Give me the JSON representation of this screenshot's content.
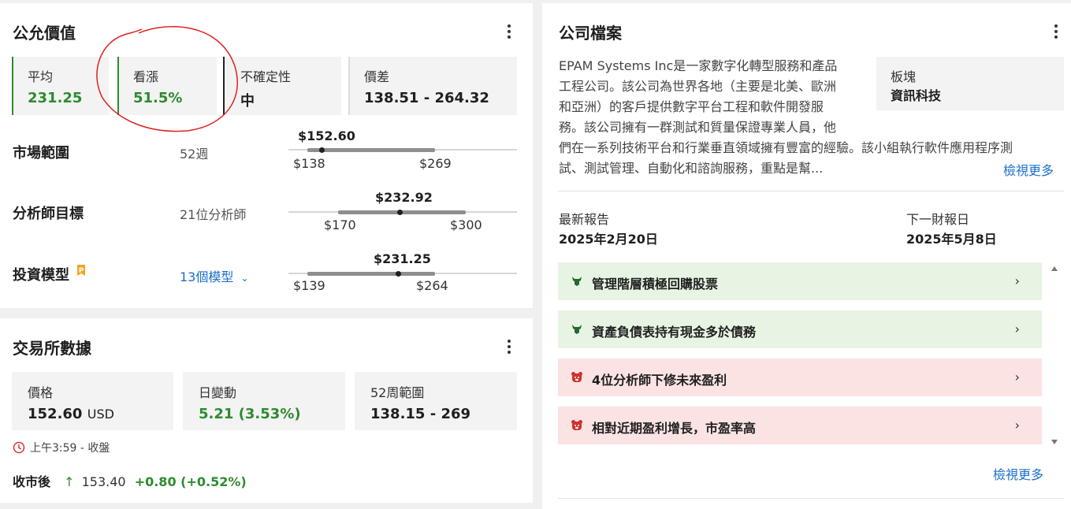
{
  "fair_value": {
    "title": "公允價值",
    "stats": [
      {
        "label": "平均",
        "value": "231.25"
      },
      {
        "label": "看漲",
        "value": "51.5%"
      },
      {
        "label": "不確定性",
        "value": "中"
      },
      {
        "label": "價差",
        "value": "138.51 - 264.32"
      }
    ],
    "rows": [
      {
        "label": "市場範圍",
        "sub": "52週",
        "current": "$152.60",
        "low": "$138",
        "high": "$269"
      },
      {
        "label": "分析師目標",
        "sub": "21位分析師",
        "current": "$232.92",
        "low": "$170",
        "high": "$300"
      },
      {
        "label": "投資模型",
        "sub": "13個模型",
        "current": "$231.25",
        "low": "$139",
        "high": "$264"
      }
    ]
  },
  "exchange": {
    "title": "交易所數據",
    "price_label": "價格",
    "price": "152.60",
    "currency": "USD",
    "change_label": "日變動",
    "change": "5.21 (3.53%)",
    "range_label": "52周範圍",
    "range": "138.15 - 269",
    "time": "上午3:59 - 收盤",
    "after_label": "收市後",
    "after_price": "153.40",
    "after_change": "+0.80 (+0.52%)"
  },
  "profile": {
    "title": "公司檔案",
    "description_lines": [
      "EPAM Systems Inc是一家數字化轉型服務和產品",
      "工程公司。該公司為世界各地（主要是北美、歐洲",
      "和亞洲）的客戶提供數字平台工程和軟件開發服",
      "務。該公司擁有一群測試和質量保證專業人員，他",
      "們在一系列技術平台和行業垂直領域擁有豐富的經驗。該小組執行軟件應用程序測",
      "試、測試管理、自動化和諮詢服務，重點是幫..."
    ],
    "sector_label": "板塊",
    "sector": "資訊科技",
    "view_more": "檢視更多",
    "latest_report_label": "最新報告",
    "latest_report": "2025年2月20日",
    "next_report_label": "下一財報日",
    "next_report": "2025年5月8日",
    "insights": [
      {
        "text": "管理階層積極回購股票",
        "sentiment": "bull"
      },
      {
        "text": "資產負債表持有現金多於債務",
        "sentiment": "bull"
      },
      {
        "text": "4位分析師下修未來盈利",
        "sentiment": "bear"
      },
      {
        "text": "相對近期盈利增長，市盈率高",
        "sentiment": "bear"
      }
    ],
    "view_more_bottom": "檢視更多"
  },
  "colors": {
    "positive": "#2e8b2e",
    "link": "#1a6fcc",
    "annotation": "#e02020"
  }
}
